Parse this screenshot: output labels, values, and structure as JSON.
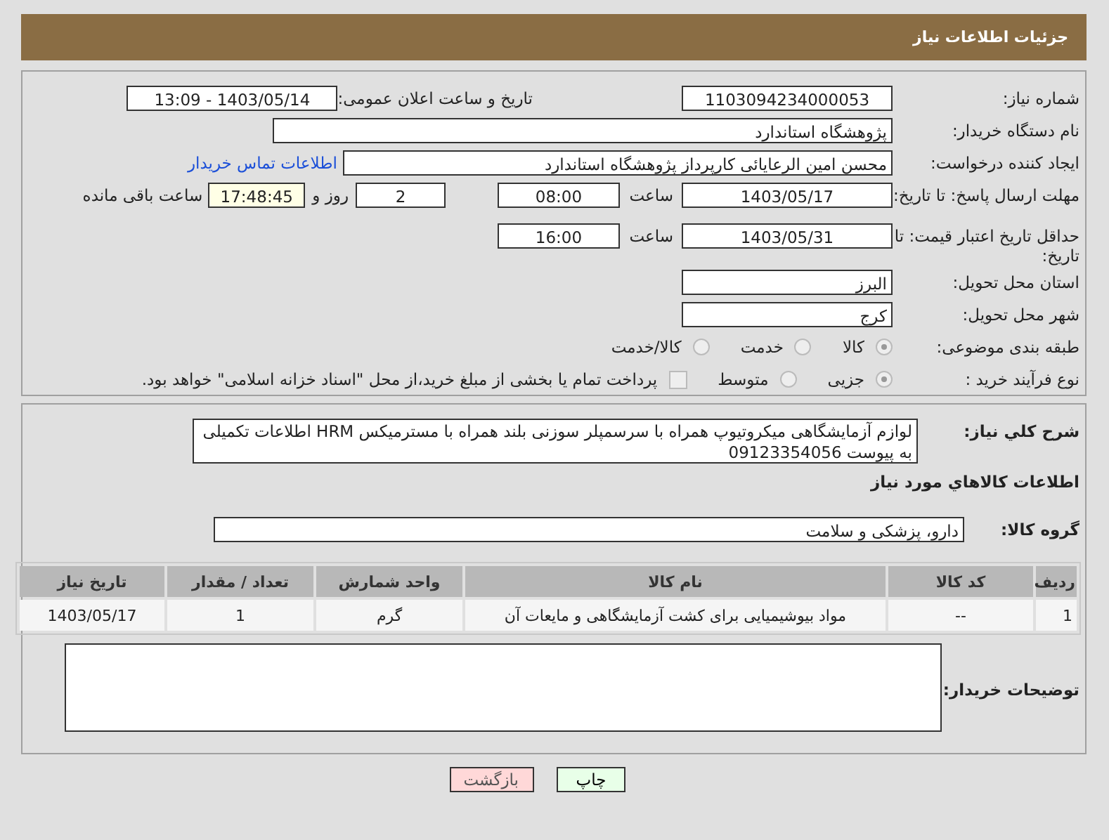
{
  "header": {
    "title": "جزئیات اطلاعات نیاز"
  },
  "need_number": {
    "label": "شماره نیاز:",
    "value": "1103094234000053"
  },
  "announce": {
    "label": "تاریخ و ساعت اعلان عمومی:",
    "value": "1403/05/14 - 13:09"
  },
  "buyer_org": {
    "label": "نام دستگاه خریدار:",
    "value": "پژوهشگاه استاندارد"
  },
  "requester": {
    "label": "ایجاد کننده درخواست:",
    "value": "محسن امین الرعایائی کارپرداز پژوهشگاه استاندارد",
    "link": "اطلاعات تماس خریدار"
  },
  "deadline": {
    "label": "مهلت ارسال پاسخ: تا تاریخ:",
    "date": "1403/05/17",
    "time_label": "ساعت",
    "time": "08:00",
    "days": "2",
    "days_label": "روز و",
    "remaining": "17:48:45",
    "remaining_label": "ساعت باقی مانده"
  },
  "validity": {
    "label": "حداقل تاریخ اعتبار قیمت: تا تاریخ:",
    "date": "1403/05/31",
    "time_label": "ساعت",
    "time": "16:00"
  },
  "province": {
    "label": "استان محل تحویل:",
    "value": "البرز"
  },
  "city": {
    "label": "شهر محل تحویل:",
    "value": "کرج"
  },
  "category": {
    "label": "طبقه بندی موضوعی:",
    "options": [
      {
        "label": "کالا",
        "selected": true
      },
      {
        "label": "خدمت",
        "selected": false
      },
      {
        "label": "کالا/خدمت",
        "selected": false
      }
    ]
  },
  "process": {
    "label": "نوع فرآیند خرید :",
    "options": [
      {
        "label": "جزیی",
        "selected": true
      },
      {
        "label": "متوسط",
        "selected": false
      }
    ],
    "treasury": {
      "checked": false,
      "text": "پرداخت تمام یا بخشی از مبلغ خرید،از محل \"اسناد خزانه اسلامی\" خواهد بود."
    }
  },
  "description": {
    "label": "شرح کلي نياز:",
    "value": "لوازم آزمایشگاهی میکروتیوپ همراه با سرسمپلر سوزنی بلند همراه با مسترمیکس HRM اطلاعات تکمیلی به پیوست 09123354056"
  },
  "items_heading": "اطلاعات کالاهاي مورد نياز",
  "goods_group": {
    "label": "گروه کالا:",
    "value": "دارو، پزشکی و سلامت"
  },
  "table": {
    "columns": [
      "ردیف",
      "کد کالا",
      "نام کالا",
      "واحد شمارش",
      "تعداد / مقدار",
      "تاریخ نیاز"
    ],
    "rows": [
      [
        "1",
        "--",
        "مواد بیوشیمیایی برای کشت آزمایشگاهی و مایعات آن",
        "گرم",
        "1",
        "1403/05/17"
      ]
    ]
  },
  "buyer_notes": {
    "label": "توضیحات خریدار:"
  },
  "buttons": [
    {
      "label": "چاپ",
      "kind": "print"
    },
    {
      "label": "بازگشت",
      "kind": "back"
    }
  ]
}
